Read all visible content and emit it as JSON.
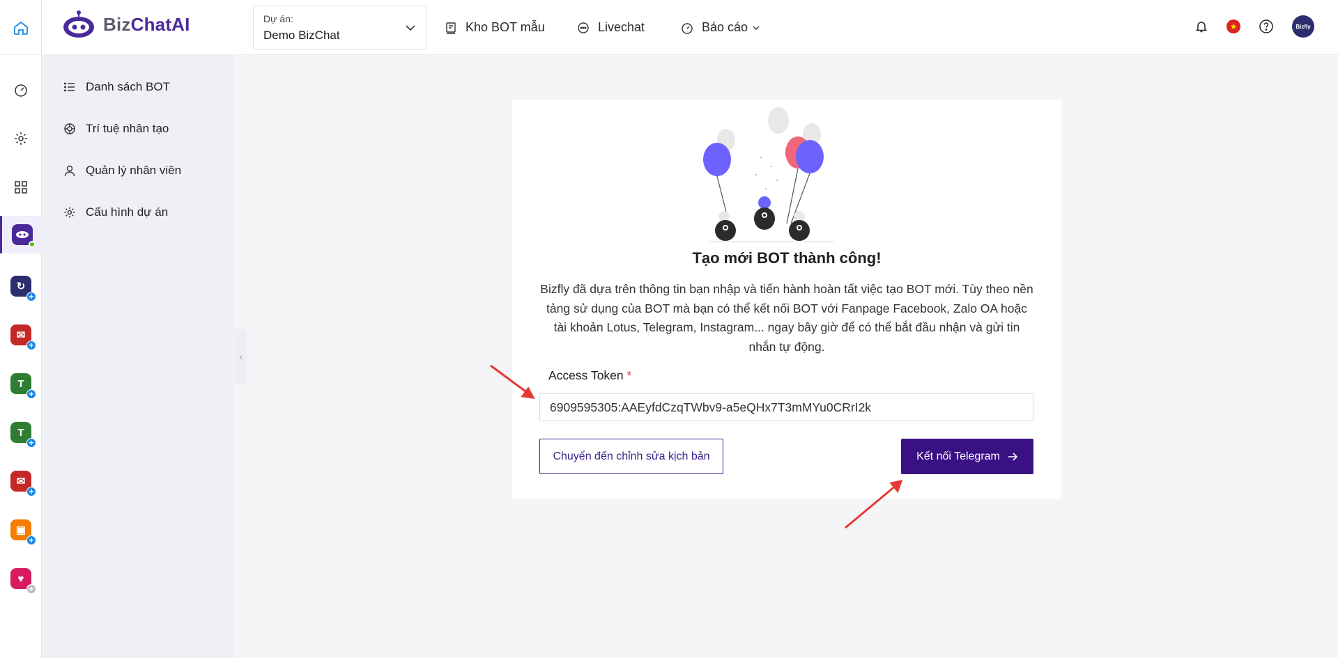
{
  "header": {
    "brand": {
      "prefix": "Biz",
      "suffix": "ChatAI"
    },
    "project": {
      "label": "Dự án:",
      "value": "Demo BizChat"
    },
    "nav": [
      {
        "label": "Kho BOT mẫu",
        "icon": "template-icon"
      },
      {
        "label": "Livechat",
        "icon": "chat-bubble-icon"
      },
      {
        "label": "Báo cáo",
        "icon": "dashboard-gauge-icon"
      }
    ],
    "avatar_text": "Bizfly"
  },
  "sidebar": {
    "items": [
      {
        "label": "Danh sách BOT",
        "icon": "list-icon"
      },
      {
        "label": "Trí tuệ nhân tạo",
        "icon": "ai-icon"
      },
      {
        "label": "Quản lý nhân viên",
        "icon": "user-icon"
      },
      {
        "label": "Cấu hình dự án",
        "icon": "gear-icon"
      }
    ]
  },
  "main": {
    "title": "Tạo mới BOT thành công!",
    "description": "Bizfly đã dựa trên thông tin bạn nhập và tiến hành hoàn tất việc tạo BOT mới. Tùy theo nền tảng sử dụng của BOT mà bạn có thể kết nối BOT với Fanpage Facebook, Zalo OA hoặc tài khoản Lotus, Telegram, Instagram... ngay bây giờ để có thể bắt đầu nhận và gửi tin nhắn tự động.",
    "token_label": "Access Token",
    "token_required": "*",
    "token_value": "6909595305:AAEyfdCzqTWbv9-a5eQHx7T3mMYu0CRrI2k",
    "secondary_button": "Chuyển đến chỉnh sửa kịch bản",
    "primary_button": "Kết nối Telegram"
  },
  "colors": {
    "brand": "#3a1183",
    "accent_arrow": "#e53935",
    "sidebar_bg": "#eef0f5"
  }
}
